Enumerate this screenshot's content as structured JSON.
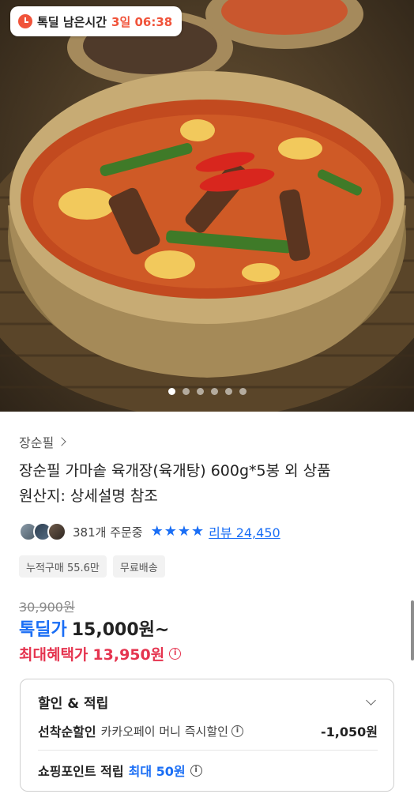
{
  "hero": {
    "image_alt": "",
    "timer": {
      "label": "톡딜 남은시간",
      "value": "3일 06:38"
    },
    "carousel_dots": 6,
    "active_dot": 0
  },
  "product": {
    "seller": "장순필",
    "title_line1": "장순필 가마솥 육개장(육개탕) 600g*5봉 외 상품",
    "title_line2": "원산지: 상세설명 참조",
    "order_count": "381개 주문중",
    "rating_stars": 4,
    "review_label": "리뷰 24,450",
    "chips": [
      "누적구매 55.6만",
      "무료배송"
    ]
  },
  "price": {
    "original": "30,900원",
    "deal_label": "톡딜가",
    "deal_price": "15,000원~",
    "max_benefit_label": "최대혜택가",
    "max_benefit_price": "13,950원"
  },
  "discount": {
    "header": "할인 & 적립",
    "row1_label": "선착순할인",
    "row1_desc": "카카오페이 머니 즉시할인",
    "row1_amount": "-1,050원",
    "row2_label": "쇼핑포인트 적립",
    "row2_value": "최대 50원"
  },
  "colors": {
    "deal_blue": "#1a6ef5",
    "benefit_red": "#e5344f",
    "timer_orange": "#f0533a"
  }
}
